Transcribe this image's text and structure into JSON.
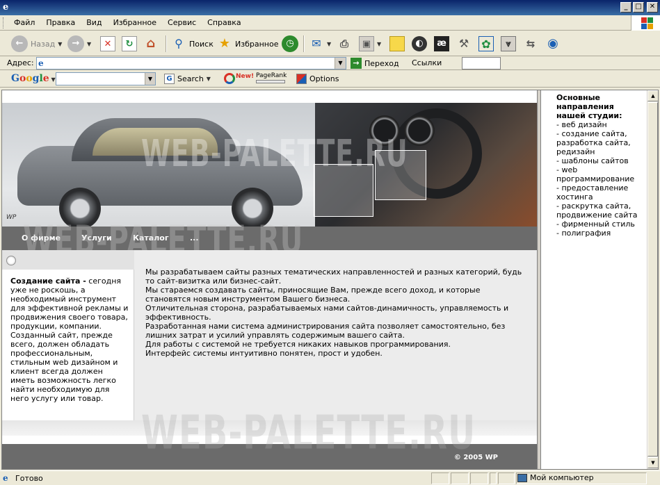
{
  "menu": {
    "items": [
      "Файл",
      "Правка",
      "Вид",
      "Избранное",
      "Сервис",
      "Справка"
    ]
  },
  "toolbar": {
    "back_label": "Назад",
    "search_label": "Поиск",
    "favorites_label": "Избранное"
  },
  "address": {
    "label": "Адрес:",
    "value": "",
    "go_label": "Переход",
    "links_label": "Ссылки"
  },
  "google": {
    "logo": [
      "G",
      "o",
      "o",
      "g",
      "l",
      "e"
    ],
    "search_label": "Search",
    "new_label": "New!",
    "pagerank_label": "PageRank",
    "options_label": "Options"
  },
  "site": {
    "watermark": "WEB-PALETTE.RU",
    "nav": [
      "О фирме",
      "Услуги",
      "Каталог",
      "..."
    ],
    "left_heading": "Создание сайта -",
    "left_text_1": " сегодня уже не роскошь, а необходимый инструмент для эффективной рекламы и продвижения своего товара, продукции, компании.",
    "left_text_2": "Созданный сайт, прежде всего, должен обладать профессиональным, стильным web дизайном и клиент всегда должен иметь возможность легко найти необходимую для него услугу или товар.",
    "main_paragraphs": [
      "Мы разрабатываем сайты разных тематических направленностей и разных категорий, будь то сайт-визитка или бизнес-сайт.",
      "Мы стараемся создавать сайты, приносящие Вам, прежде всего доход, и которые становятся новым инструментом Вашего бизнеса.",
      "Отличительная сторона, разрабатываемых нами сайтов-динамичность, управляемость и эффективность.",
      "Разработанная нами система администрирования сайта позволяет самостоятельно, без лишних затрат и усилий управлять содержимым вашего сайта.",
      "Для работы с системой не требуется никаких навыков программирования.",
      "Интерфейс системы интуитивно понятен, прост и удобен."
    ],
    "footer": "© 2005 WP",
    "banner_mark": "WP"
  },
  "sidebar": {
    "heading": "Основные направления нашей студии:",
    "items": [
      "- веб дизайн",
      "- создание сайта, разработка сайта, редизайн",
      "- шаблоны сайтов",
      "- web программирование",
      "- предоставление хостинга",
      "- раскрутка сайта, продвижение сайта",
      "- фирменный стиль",
      "- полиграфия"
    ]
  },
  "status": {
    "left": "Готово",
    "zone": "Мой компьютер"
  }
}
